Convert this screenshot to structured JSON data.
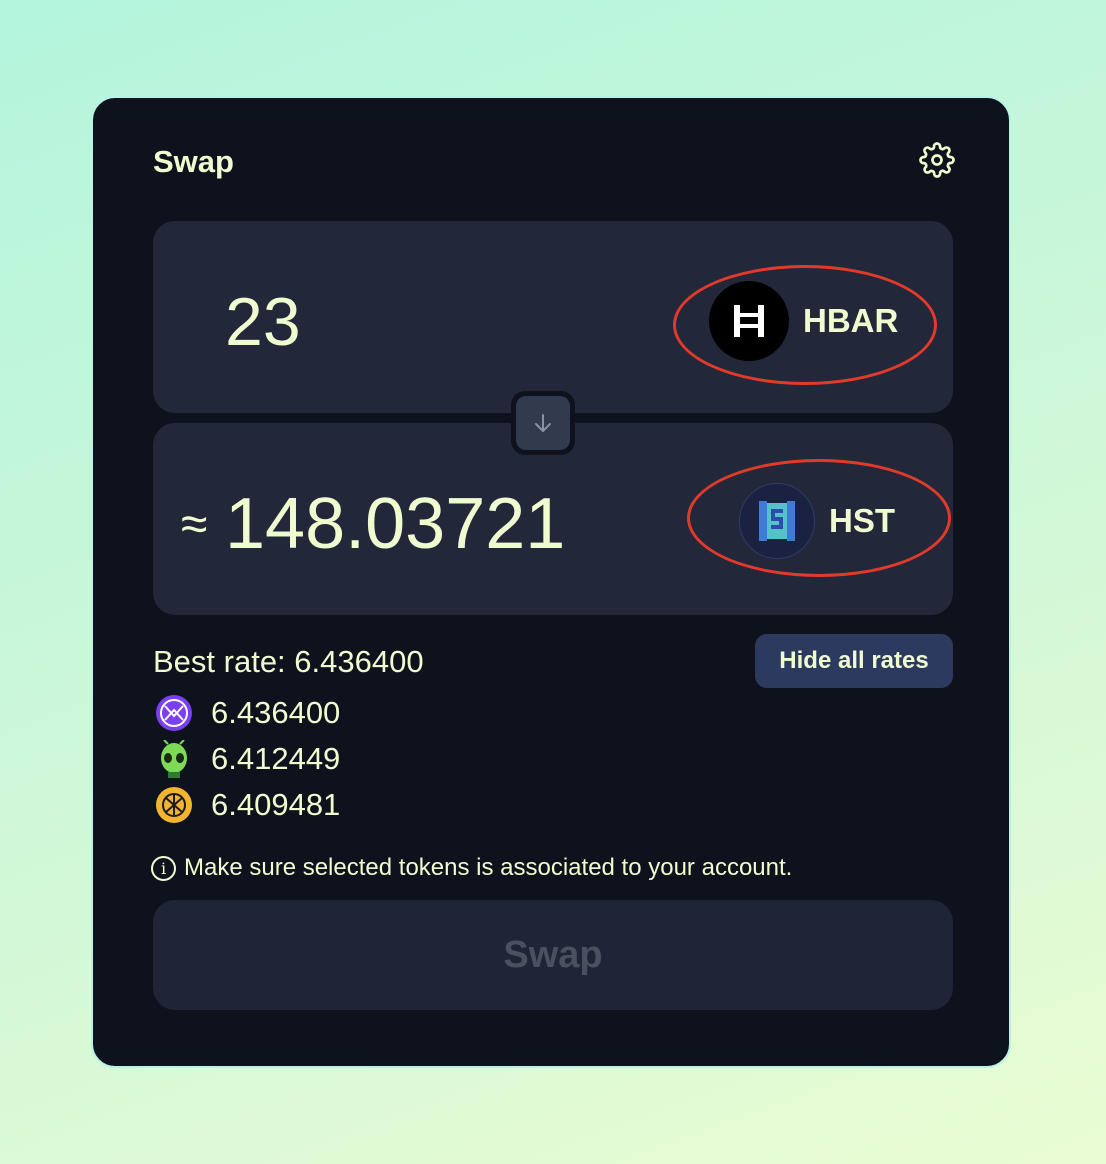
{
  "header": {
    "title": "Swap"
  },
  "from": {
    "amount": "23",
    "token": "HBAR"
  },
  "to": {
    "approx_symbol": "≈",
    "amount": "148.03721",
    "token": "HST"
  },
  "rates": {
    "best_rate_label": "Best rate: 6.436400",
    "toggle_label": "Hide all rates",
    "list": [
      {
        "icon": "purple-dex-icon",
        "value": "6.436400"
      },
      {
        "icon": "alien-dex-icon",
        "value": "6.412449"
      },
      {
        "icon": "yellow-dex-icon",
        "value": "6.409481"
      }
    ]
  },
  "notice": {
    "icon": "ⓘ",
    "text": "Make sure selected tokens is associated to your account."
  },
  "action": {
    "swap_label": "Swap"
  },
  "colors": {
    "accent_text": "#eefcd0",
    "card_bg": "#0e121c",
    "panel_bg": "#222839",
    "annotation_ring": "#e23a2a"
  }
}
